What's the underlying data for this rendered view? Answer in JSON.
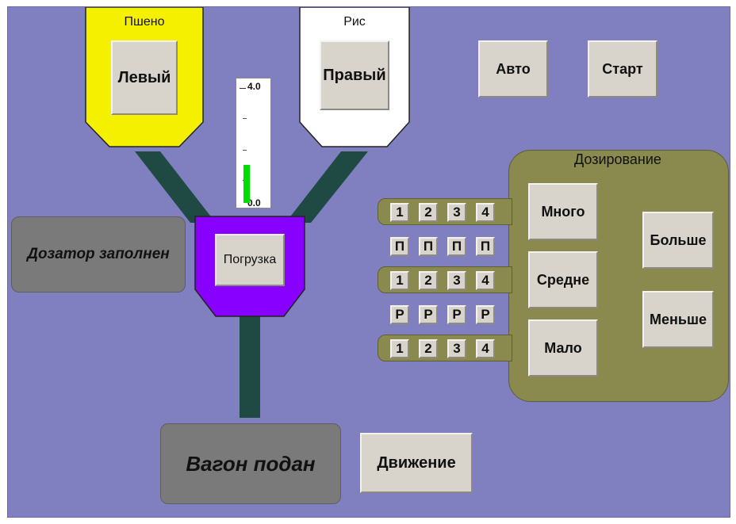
{
  "hoppers": {
    "left": {
      "title": "Пшено",
      "button": "Левый",
      "color": "#f5f000"
    },
    "right": {
      "title": "Рис",
      "button": "Правый",
      "color": "#ffffff"
    }
  },
  "gauge": {
    "max_label": "4.0",
    "min_label": "0.0",
    "value": 0.35,
    "bar_color": "#00dd00"
  },
  "loader": {
    "button": "Погрузка",
    "color": "#8800ff"
  },
  "pipe_color": "#1f4a44",
  "status": {
    "dispenser": "Дозатор заполнен",
    "wagon": "Вагон подан"
  },
  "buttons": {
    "auto": "Авто",
    "start": "Старт",
    "move": "Движение"
  },
  "dosing": {
    "title": "Дозирование",
    "panel_color": "#8a8a4e",
    "levels": [
      "Много",
      "Средне",
      "Мало"
    ],
    "more": "Больше",
    "less": "Меньше",
    "rows": [
      [
        "1",
        "2",
        "3",
        "4"
      ],
      [
        "П",
        "П",
        "П",
        "П"
      ],
      [
        "1",
        "2",
        "3",
        "4"
      ],
      [
        "Р",
        "Р",
        "Р",
        "Р"
      ],
      [
        "1",
        "2",
        "3",
        "4"
      ]
    ]
  }
}
